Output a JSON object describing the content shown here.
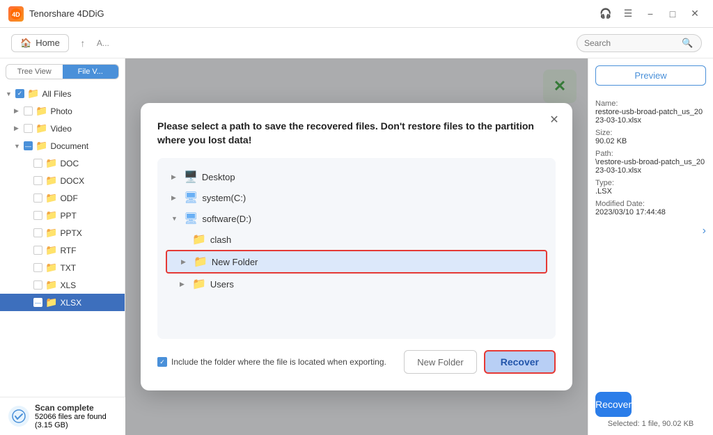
{
  "app": {
    "title": "Tenorshare 4DDiG",
    "logo_text": "4D"
  },
  "titlebar": {
    "controls": {
      "headset": "🎧",
      "menu": "☰",
      "minimize": "−",
      "maximize": "□",
      "close": "✕"
    }
  },
  "toolbar": {
    "home_label": "Home",
    "search_placeholder": "Search"
  },
  "view_toggle": {
    "tree_view": "Tree View",
    "file_view": "File V..."
  },
  "sidebar": {
    "items": [
      {
        "label": "All Files",
        "icon": "folder",
        "color": "blue",
        "indent": 0,
        "chevron": "▼",
        "checked": true
      },
      {
        "label": "Photo",
        "icon": "folder",
        "color": "blue",
        "indent": 1,
        "chevron": "▶",
        "checked": false
      },
      {
        "label": "Video",
        "icon": "folder",
        "color": "blue",
        "indent": 1,
        "chevron": "▶",
        "checked": false
      },
      {
        "label": "Document",
        "icon": "folder",
        "color": "blue",
        "indent": 1,
        "chevron": "▼",
        "checked": true,
        "dash": true
      },
      {
        "label": "DOC",
        "icon": "folder",
        "color": "yellow",
        "indent": 2,
        "checked": false
      },
      {
        "label": "DOCX",
        "icon": "folder",
        "color": "yellow",
        "indent": 2,
        "checked": false
      },
      {
        "label": "ODF",
        "icon": "folder",
        "color": "yellow",
        "indent": 2,
        "checked": false
      },
      {
        "label": "PPT",
        "icon": "folder",
        "color": "yellow",
        "indent": 2,
        "checked": false
      },
      {
        "label": "PPTX",
        "icon": "folder",
        "color": "yellow",
        "indent": 2,
        "checked": false
      },
      {
        "label": "RTF",
        "icon": "folder",
        "color": "yellow",
        "indent": 2,
        "checked": false
      },
      {
        "label": "TXT",
        "icon": "folder",
        "color": "yellow",
        "indent": 2,
        "checked": false
      },
      {
        "label": "XLS",
        "icon": "folder",
        "color": "yellow",
        "indent": 2,
        "checked": false
      },
      {
        "label": "XLSX",
        "icon": "folder",
        "color": "yellow",
        "indent": 2,
        "checked": false,
        "active": true
      }
    ]
  },
  "right_panel": {
    "preview_label": "Preview",
    "name_label": "Name:",
    "name_value": "restore-usb-broad-patch_us_2023-03-10.xlsx",
    "size_label": "Size:",
    "size_value": "90.02 KB",
    "path_label": "Path:",
    "path_value": "\\restore-usb-broad-patch_us_2023-03-10.xlsx",
    "type_label": "Type:",
    "type_value": ".LSX",
    "date_label": "Modified Date:",
    "date_value": "2023/03/10 17:44:48",
    "recover_label": "Recover",
    "selected_info": "Selected: 1 file, 90.02 KB"
  },
  "status": {
    "title": "Scan complete",
    "detail": "52066 files are found (3.15 GB)"
  },
  "dialog": {
    "title": "Please select a path to save the recovered files. Don't restore files to the partition where you lost data!",
    "close_icon": "✕",
    "tree": {
      "items": [
        {
          "label": "Desktop",
          "indent": 0,
          "chevron": "▶",
          "icon": "🖥️",
          "icon_type": "monitor"
        },
        {
          "label": "system(C:)",
          "indent": 0,
          "chevron": "▶",
          "icon": "🖥",
          "icon_type": "computer"
        },
        {
          "label": "software(D:)",
          "indent": 0,
          "chevron": "▼",
          "icon": "🖥",
          "icon_type": "computer",
          "expanded": true
        },
        {
          "label": "clash",
          "indent": 1,
          "chevron": "",
          "icon": "📁",
          "icon_type": "folder_yellow"
        },
        {
          "label": "New Folder",
          "indent": 1,
          "chevron": "▶",
          "icon": "📁",
          "icon_type": "folder_yellow",
          "highlighted": true
        },
        {
          "label": "Users",
          "indent": 1,
          "chevron": "▶",
          "icon": "📁",
          "icon_type": "folder_yellow"
        }
      ]
    },
    "checkbox_label": "Include the folder where the file is located when exporting.",
    "checkbox_checked": true,
    "new_folder_label": "New Folder",
    "recover_label": "Recover"
  }
}
